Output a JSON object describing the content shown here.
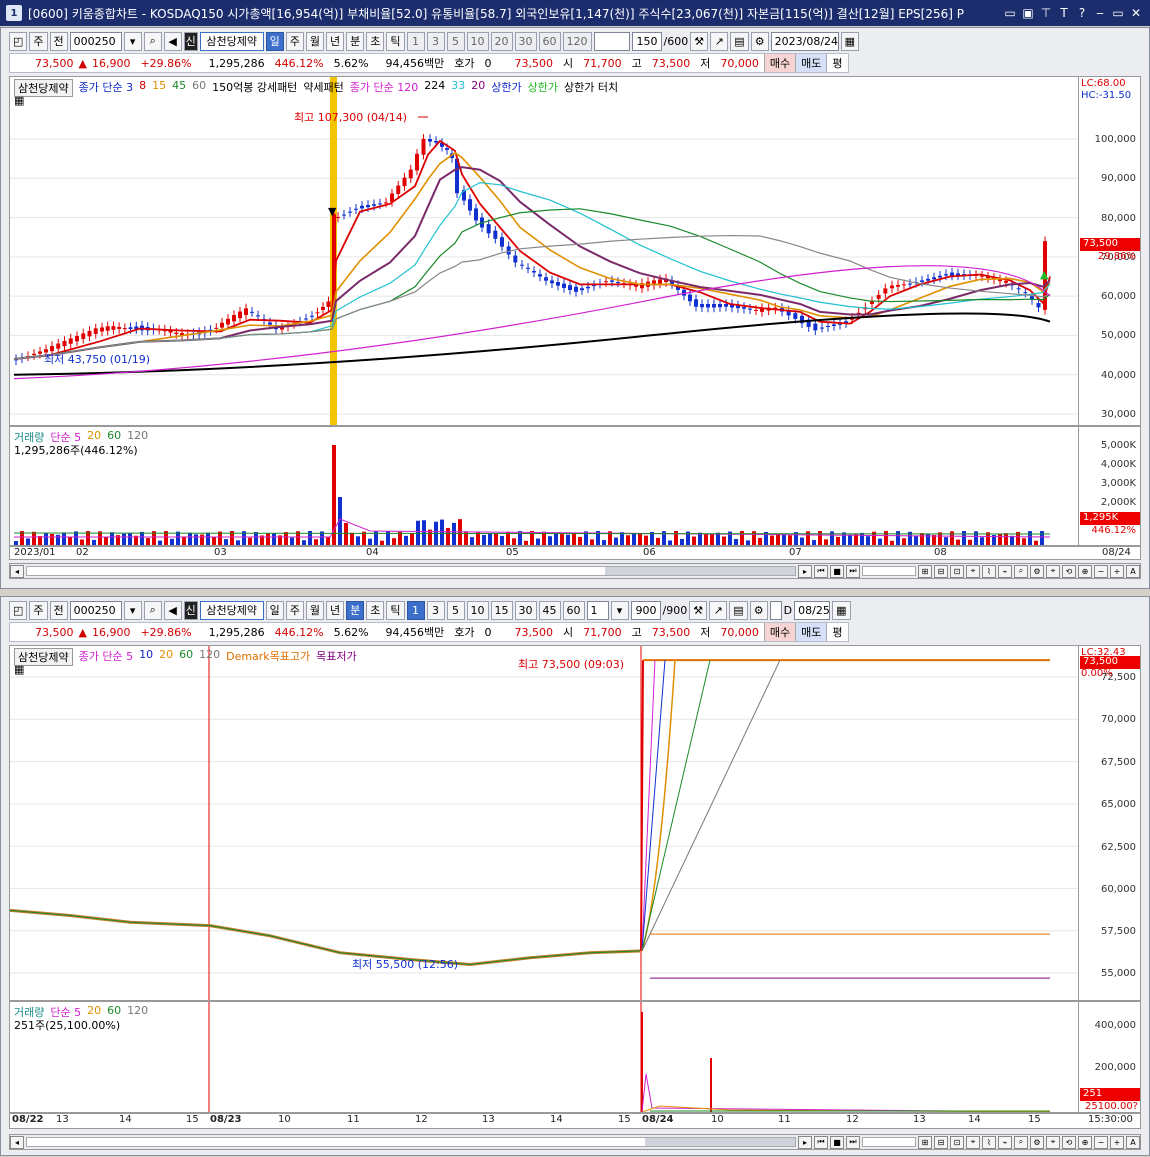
{
  "window": {
    "title": "[0600] 키움종합차트 - KOSDAQ150 시가총액[16,954(억)] 부채비율[52.0] 유통비율[58.7] 외국인보유[1,147(천)] 주식수[23,067(천)] 자본금[115(억)] 결산[12월] EPS[256] P",
    "number": "1",
    "buttons": [
      "▭",
      "▭",
      "▬",
      "T",
      "?",
      "‒",
      "▭",
      "✕"
    ]
  },
  "top": {
    "toolbar": {
      "type1": "주",
      "type2": "전",
      "code": "000250",
      "shin": "신",
      "name": "삼천당제약",
      "periods": [
        "일",
        "주",
        "월",
        "년",
        "분",
        "초",
        "틱"
      ],
      "active_period": "일",
      "intervals": [
        "1",
        "3",
        "5",
        "10",
        "20",
        "30",
        "60",
        "120"
      ],
      "count": "150",
      "count_max": "/600",
      "date": "2023/08/24"
    },
    "quote": {
      "price": "73,500",
      "arrow": "▲",
      "change": "16,900",
      "rate": "+29.86%",
      "volume": "1,295,286",
      "vol_rate": "446.12%",
      "turnover": "5.62%",
      "amount": "94,456백만",
      "hoga_label": "호가",
      "hoga": "0",
      "cur": "73,500",
      "open_label": "시",
      "open": "71,700",
      "high_label": "고",
      "high": "73,500",
      "low_label": "저",
      "low": "70,000",
      "buy": "매수",
      "sell": "매도",
      "avg": "평"
    },
    "legend": [
      "삼천당제약",
      "종가 단순 3",
      "8",
      "15",
      "45",
      "60",
      "150억봉 강세패턴",
      "약세패턴",
      "종가 단순 120",
      "224",
      "33",
      "20",
      "상한가",
      "상한가",
      "상한가 터치"
    ],
    "legend_right": [
      "LC:68.00",
      "HC:-31.50"
    ],
    "high_note": "최고 107,300 (04/14)",
    "low_note": "최저 43,750 (01/19)",
    "price_ticks": [
      "100,000",
      "90,000",
      "80,000",
      "70,000",
      "60,000",
      "50,000",
      "40,000",
      "30,000"
    ],
    "price_badge": "73,500",
    "price_badge_rate": "29.86%",
    "vol_legend": [
      "거래량",
      "단순 5",
      "20",
      "60",
      "120"
    ],
    "vol_info": "1,295,286주(446.12%)",
    "vol_ticks": [
      "5,000K",
      "4,000K",
      "3,000K",
      "2,000K"
    ],
    "vol_badge": "1,295K",
    "vol_badge_rate": "446.12%",
    "x_labels": [
      "2023/01",
      "02",
      "03",
      "04",
      "05",
      "06",
      "07",
      "08",
      "08/24"
    ]
  },
  "bottom": {
    "toolbar": {
      "type1": "주",
      "type2": "전",
      "code": "000250",
      "shin": "신",
      "name": "삼천당제약",
      "periods": [
        "일",
        "주",
        "월",
        "년",
        "분",
        "초",
        "틱"
      ],
      "active_period": "분",
      "intervals": [
        "1",
        "3",
        "5",
        "10",
        "15",
        "30",
        "45",
        "60"
      ],
      "count_sel": "1",
      "count": "900",
      "count_max": "/900",
      "date": "08/25",
      "d_label": "D"
    },
    "quote": {
      "price": "73,500",
      "arrow": "▲",
      "change": "16,900",
      "rate": "+29.86%",
      "volume": "1,295,286",
      "vol_rate": "446.12%",
      "turnover": "5.62%",
      "amount": "94,456백만",
      "hoga_label": "호가",
      "hoga": "0",
      "cur": "73,500",
      "open_label": "시",
      "open": "71,700",
      "high_label": "고",
      "high": "73,500",
      "low_label": "저",
      "low": "70,000",
      "buy": "매수",
      "sell": "매도",
      "avg": "평"
    },
    "legend": [
      "삼천당제약",
      "종가 단순 5",
      "10",
      "20",
      "60",
      "120",
      "Demark목표고가",
      "목표저가"
    ],
    "legend_right": [
      "LC:32.43",
      "0.00%"
    ],
    "high_note": "최고 73,500 (09:03)",
    "low_note": "최저 55,500 (12:56)",
    "price_ticks": [
      "72,500",
      "70,000",
      "67,500",
      "65,000",
      "62,500",
      "60,000",
      "57,500",
      "55,000"
    ],
    "price_badge": "73,500",
    "vol_legend": [
      "거래량",
      "단순 5",
      "20",
      "60",
      "120"
    ],
    "vol_info": "251주(25,100.00%)",
    "vol_ticks": [
      "400,000",
      "200,000"
    ],
    "vol_badge": "251",
    "vol_badge_rate": "25100.00?",
    "x_labels": [
      "08/22",
      "13",
      "14",
      "15",
      "08/23",
      "10",
      "11",
      "12",
      "13",
      "14",
      "15",
      "08/24",
      "10",
      "11",
      "12",
      "13",
      "14",
      "15",
      "15:30:00"
    ]
  },
  "colors": {
    "up": "#e00000",
    "down": "#1030d0",
    "highlight": "#f5c400"
  }
}
